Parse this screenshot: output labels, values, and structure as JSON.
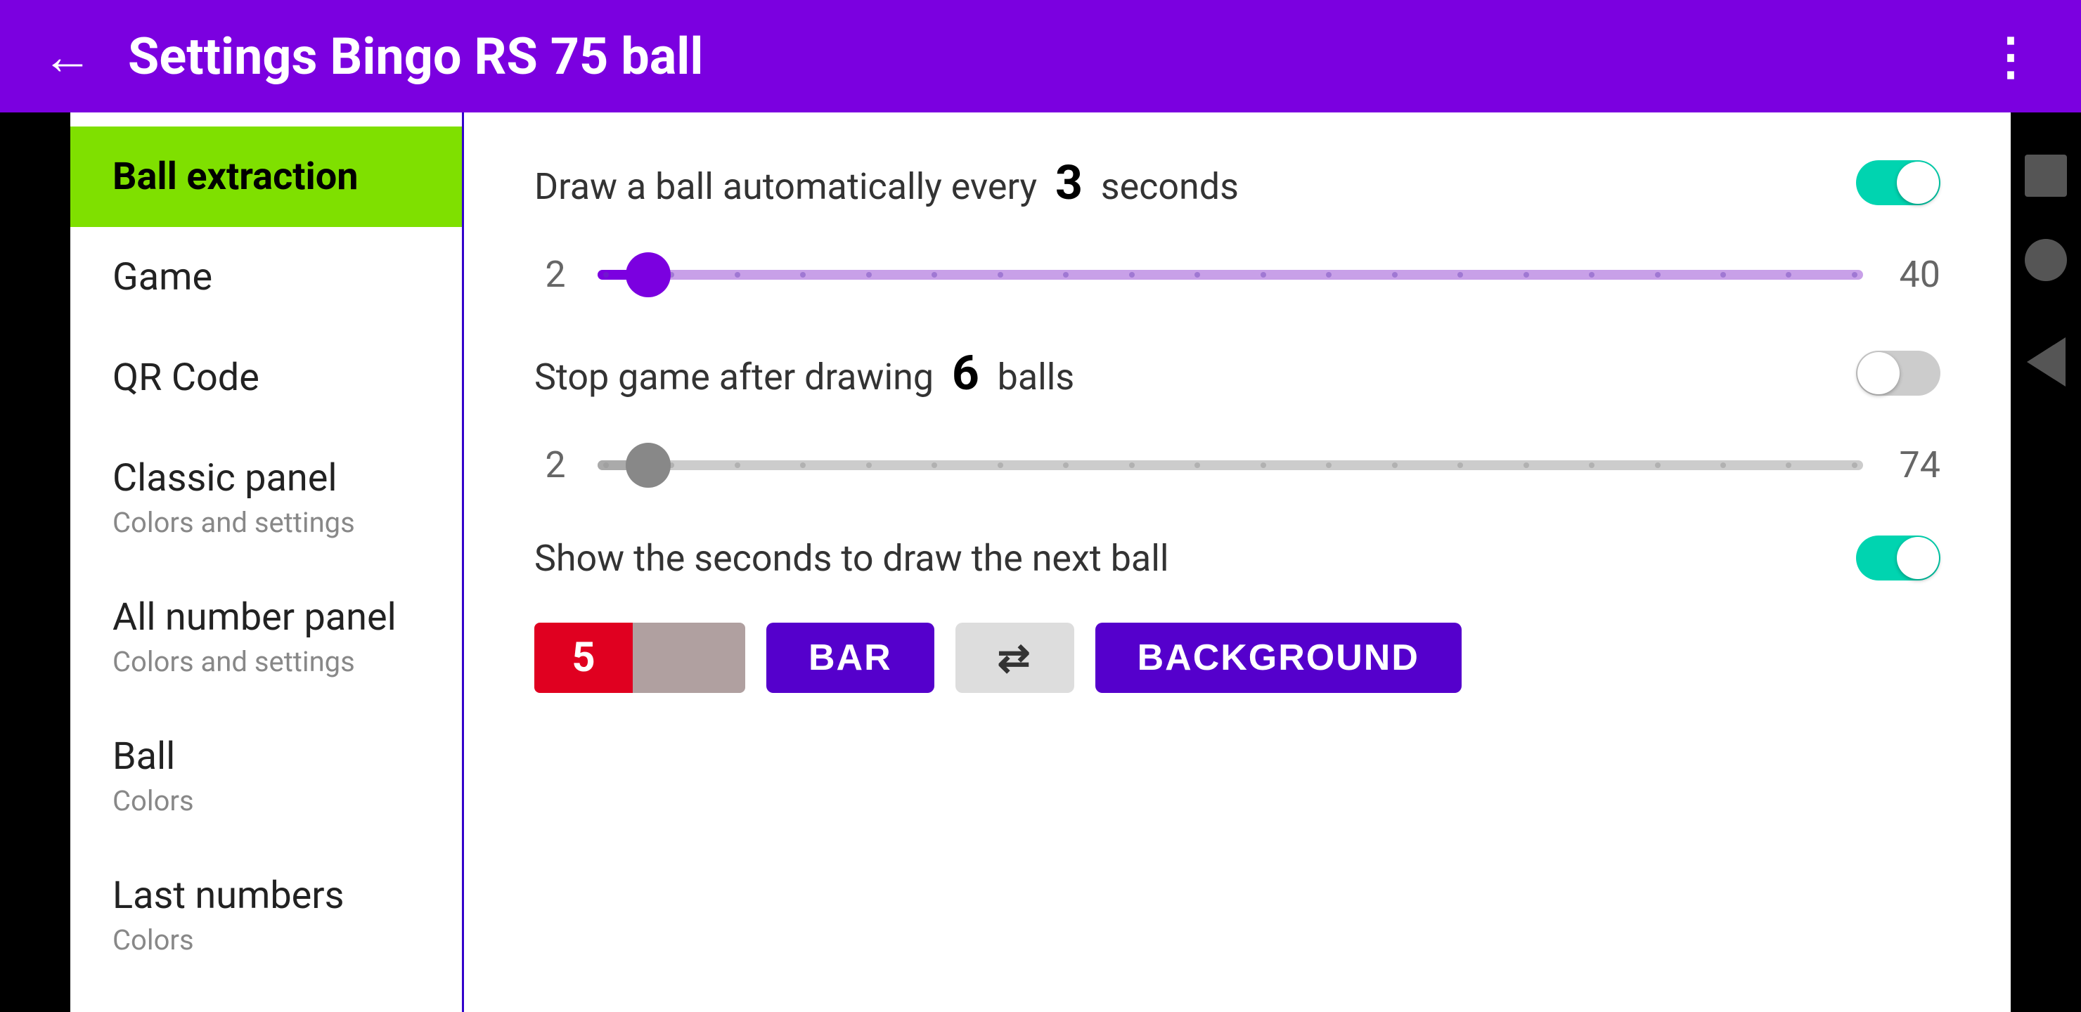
{
  "header": {
    "title": "Settings Bingo RS 75 ball",
    "back_label": "←",
    "more_label": "⋮"
  },
  "sidebar": {
    "items": [
      {
        "id": "ball-extraction",
        "title": "Ball extraction",
        "subtitle": "",
        "active": true
      },
      {
        "id": "game",
        "title": "Game",
        "subtitle": "",
        "active": false
      },
      {
        "id": "qr-code",
        "title": "QR Code",
        "subtitle": "",
        "active": false
      },
      {
        "id": "classic-panel",
        "title": "Classic panel",
        "subtitle": "Colors and settings",
        "active": false
      },
      {
        "id": "all-number-panel",
        "title": "All number panel",
        "subtitle": "Colors and settings",
        "active": false
      },
      {
        "id": "ball",
        "title": "Ball",
        "subtitle": "Colors",
        "active": false
      },
      {
        "id": "last-numbers",
        "title": "Last numbers",
        "subtitle": "Colors",
        "active": false
      }
    ]
  },
  "content": {
    "auto_draw": {
      "label_prefix": "Draw a ball automatically every",
      "value": "3",
      "label_suffix": "seconds",
      "toggle_on": true
    },
    "auto_draw_slider": {
      "min": "2",
      "max": "40",
      "value": 2,
      "total": 40
    },
    "stop_game": {
      "label_prefix": "Stop game after drawing",
      "value": "6",
      "label_suffix": "balls",
      "toggle_on": false
    },
    "stop_game_slider": {
      "min": "2",
      "max": "74",
      "value": 2,
      "total": 74
    },
    "show_seconds": {
      "label": "Show the seconds to draw the next ball",
      "toggle_on": true
    },
    "bottom_buttons": {
      "number_preview": "5",
      "bar_label": "BAR",
      "swap_label": "⇄",
      "background_label": "BACKGROUND"
    }
  }
}
